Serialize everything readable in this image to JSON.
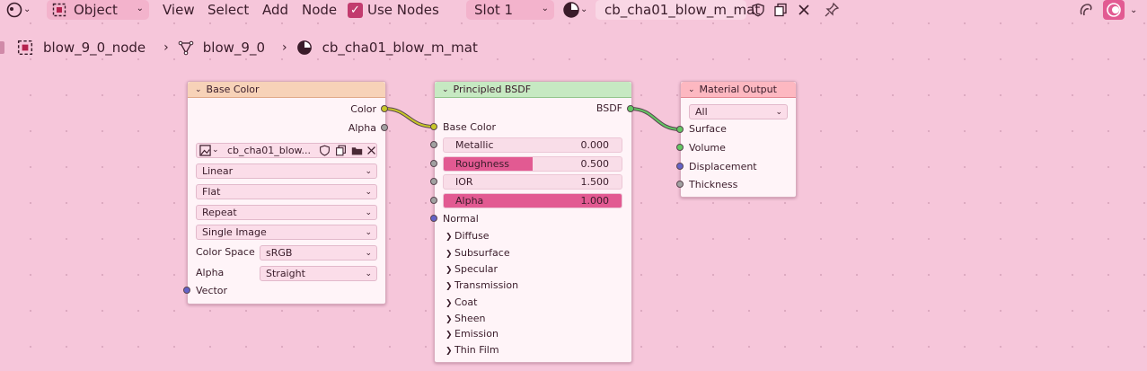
{
  "header": {
    "mode_label": "Object",
    "menus": [
      "View",
      "Select",
      "Add",
      "Node"
    ],
    "use_nodes_label": "Use Nodes",
    "use_nodes_checked": true,
    "slot_label": "Slot 1",
    "material_name": "cb_cha01_blow_m_mat"
  },
  "breadcrumb": {
    "object": "blow_9_0_node",
    "mesh": "blow_9_0",
    "material": "cb_cha01_blow_m_mat"
  },
  "nodes": {
    "base_color": {
      "title": "Base Color",
      "outputs": [
        "Color",
        "Alpha"
      ],
      "image_name": "cb_cha01_blow...",
      "interpolation": "Linear",
      "projection": "Flat",
      "extension": "Repeat",
      "source": "Single Image",
      "color_space_label": "Color Space",
      "color_space_value": "sRGB",
      "alpha_label": "Alpha",
      "alpha_value": "Straight",
      "input_vector": "Vector"
    },
    "principled": {
      "title": "Principled BSDF",
      "output": "BSDF",
      "base_color_label": "Base Color",
      "sliders": [
        {
          "label": "Metallic",
          "value": "0.000",
          "fraction": 0.0
        },
        {
          "label": "Roughness",
          "value": "0.500",
          "fraction": 0.5
        },
        {
          "label": "IOR",
          "value": "1.500",
          "fraction": 0.0
        },
        {
          "label": "Alpha",
          "value": "1.000",
          "fraction": 1.0
        }
      ],
      "normal_label": "Normal",
      "panels": [
        "Diffuse",
        "Subsurface",
        "Specular",
        "Transmission",
        "Coat",
        "Sheen",
        "Emission",
        "Thin Film"
      ]
    },
    "material_output": {
      "title": "Material Output",
      "target": "All",
      "inputs": [
        "Surface",
        "Volume",
        "Displacement",
        "Thickness"
      ]
    }
  },
  "colors": {
    "background": "#f6c6da",
    "accent": "#e25a92",
    "texture_header": "#f7d2b8",
    "shader_header": "#c6e9c2",
    "output_header": "#fdb8c1",
    "socket_color": "#c7c729",
    "socket_float": "#a1a1a1",
    "socket_shader": "#63c763",
    "socket_vector": "#6363c7"
  }
}
